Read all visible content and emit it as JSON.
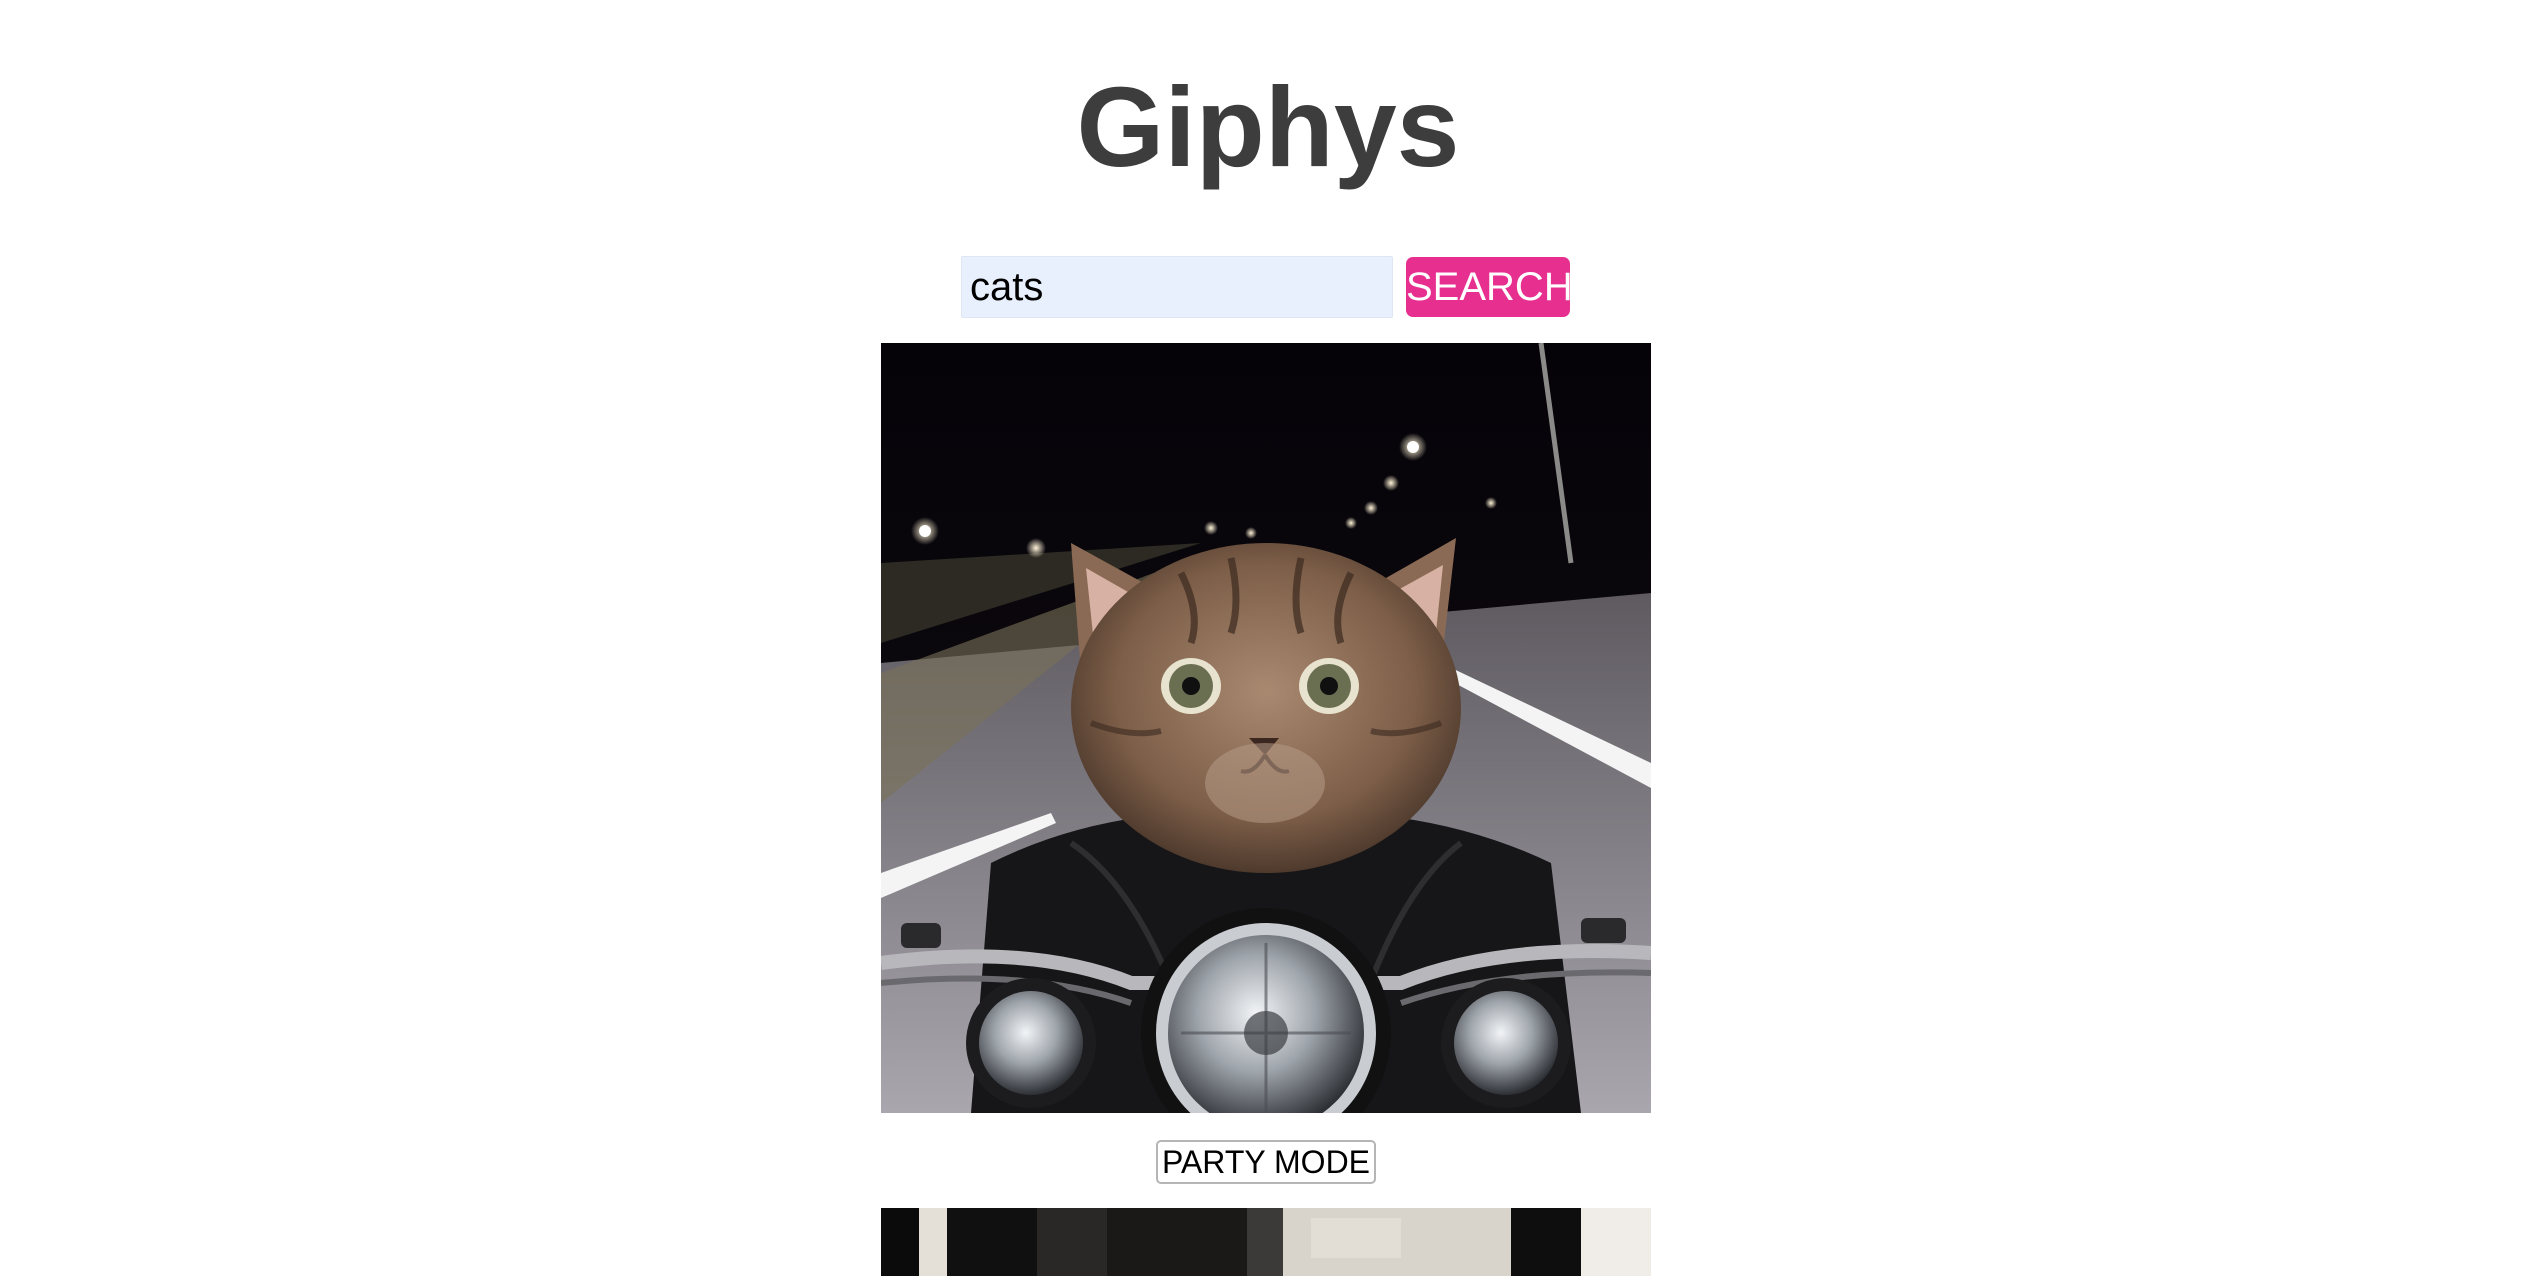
{
  "header": {
    "title": "Giphys"
  },
  "search": {
    "value": "cats",
    "placeholder": "",
    "button_label": "SEARCH"
  },
  "results": [
    {
      "party_mode_label": "PARTY MODE"
    },
    {
      "party_mode_label": ""
    }
  ],
  "colors": {
    "title": "#3d3d3d",
    "search_button": "#e62f8f",
    "search_input_bg": "#e8f0fe"
  }
}
